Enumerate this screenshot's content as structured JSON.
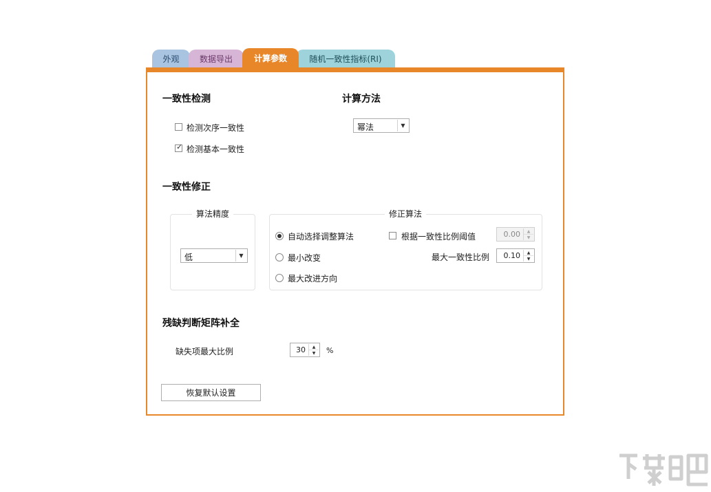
{
  "tabs": [
    {
      "label": "外观"
    },
    {
      "label": "数据导出"
    },
    {
      "label": "计算参数"
    },
    {
      "label": "随机一致性指标(RI)"
    }
  ],
  "consistency_check": {
    "title": "一致性检测",
    "options": [
      {
        "label": "检测次序一致性",
        "checked": false
      },
      {
        "label": "检测基本一致性",
        "checked": true
      }
    ]
  },
  "calc_method": {
    "title": "计算方法",
    "selected": "幂法"
  },
  "correction": {
    "title": "一致性修正",
    "precision": {
      "legend": "算法精度",
      "selected": "低"
    },
    "algorithm": {
      "legend": "修正算法",
      "radios": [
        {
          "label": "自动选择调整算法",
          "selected": true
        },
        {
          "label": "最小改变",
          "selected": false
        },
        {
          "label": "最大改进方向",
          "selected": false
        }
      ],
      "threshold_checkbox": {
        "label": "根据一致性比例阈值",
        "checked": false
      },
      "threshold_value": "0.00",
      "max_ratio_label": "最大一致性比例",
      "max_ratio_value": "0.10"
    }
  },
  "matrix_completion": {
    "title": "残缺判断矩阵补全",
    "max_missing_label": "缺失项最大比例",
    "max_missing_value": "30",
    "unit": "%"
  },
  "restore_button": "恢复默认设置",
  "colors": {
    "accent": "#e7872a",
    "tab_blue": "#a9c4e0",
    "tab_pink": "#d7b5d6",
    "tab_cyan": "#9ed3dc"
  }
}
